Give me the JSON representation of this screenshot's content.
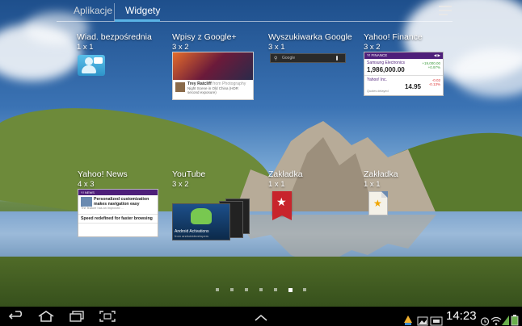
{
  "tabs": {
    "apps_label": "Aplikacje",
    "widgets_label": "Widgety",
    "active": "Widgety"
  },
  "widgets": [
    {
      "name": "Wiad. bezpośrednia",
      "size": "1 x 1",
      "icon": "direct-message-icon"
    },
    {
      "name": "Wpisy z Google+",
      "size": "3 x 2",
      "preview": {
        "author": "Trey Ratcliff",
        "author_suffix": "from Photography",
        "text": "Night Scene in Old China (HDR second exposure)"
      }
    },
    {
      "name": "Wyszukiwarka Google",
      "size": "3 x 1",
      "preview": {
        "placeholder": "Google"
      }
    },
    {
      "name": "Yahoo! Finance",
      "size": "3 x 2",
      "preview": {
        "brand": "FINANCE",
        "stocks": [
          {
            "name": "Samsung Electronics",
            "price": "1,986,000.00",
            "change": "+19,000.00",
            "change_pct": "+0.97%"
          },
          {
            "name": "Yahoo! Inc.",
            "price": "14.95",
            "change": "-0.02",
            "change_pct": "-0.13%"
          }
        ],
        "footer": "Quotes delayed"
      }
    },
    {
      "name": "Yahoo! News",
      "size": "4 x 3",
      "preview": {
        "brand": "NEWS",
        "stories": [
          {
            "headline": "Personalized customization makes navigation easy",
            "body": "The feature has an improved ..."
          },
          {
            "headline": "Speed redefined for faster browsing",
            "body": ""
          }
        ]
      }
    },
    {
      "name": "YouTube",
      "size": "3 x 2",
      "preview": {
        "title": "Android Activations",
        "subtitle": "from androiddevelopers"
      }
    },
    {
      "name": "Zakładka",
      "size": "1 x 1",
      "icon": "bookmark-red-icon"
    },
    {
      "name": "Zakładka",
      "size": "1 x 1",
      "icon": "bookmark-doc-icon"
    }
  ],
  "page_indicator": {
    "count": 7,
    "active_index": 5
  },
  "status_bar": {
    "time": "14:23"
  },
  "colors": {
    "tab_accent": "#5ab4e6",
    "yahoo_purple": "#4e1f7a",
    "bookmark_red": "#c8242c"
  }
}
